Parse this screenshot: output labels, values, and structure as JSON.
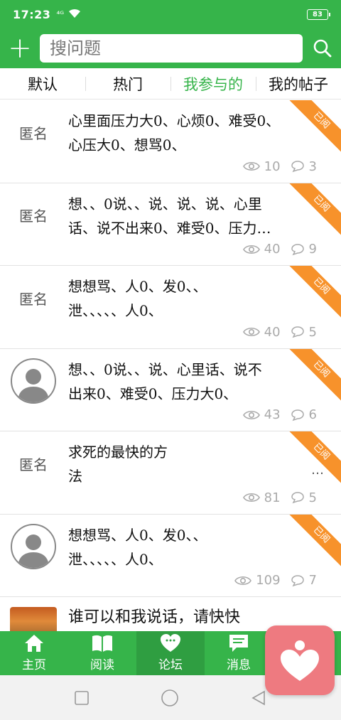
{
  "status": {
    "time": "17:23",
    "signal": "⁴ᴳ",
    "battery": "83"
  },
  "search": {
    "placeholder": "搜问题"
  },
  "tabs": [
    {
      "label": "默认"
    },
    {
      "label": "热门"
    },
    {
      "label": "我参与的"
    },
    {
      "label": "我的帖子"
    }
  ],
  "posts": [
    {
      "author": "匿名",
      "text": "心里面压力大0、心烦0、难受0、\n心压大0、想骂0、",
      "views": "10",
      "comments": "3",
      "badge": "已阅"
    },
    {
      "author": "匿名",
      "text": "想、、0说、、说、说、说、心里\n话、说不出来0、难受0、压力…",
      "views": "40",
      "comments": "9",
      "badge": "已阅"
    },
    {
      "author": "匿名",
      "text": "想想骂、人0、发0、、\n泄、、、、、人0、",
      "views": "40",
      "comments": "5",
      "badge": "已阅"
    },
    {
      "author": "",
      "text": "想、、0说、、说、心里话、说不\n出来0、难受0、压力大0、",
      "views": "43",
      "comments": "6",
      "badge": "已阅"
    },
    {
      "author": "匿名",
      "text": "求死的最快的方\n法",
      "more": "…",
      "views": "81",
      "comments": "5",
      "badge": "已阅"
    },
    {
      "author": "",
      "text": "想想骂、人0、发0、、\n泄、、、、、人0、",
      "views": "109",
      "comments": "7",
      "badge": "已阅"
    }
  ],
  "partial_post": {
    "text": "谁可以和我说话，请快快"
  },
  "nav": [
    {
      "label": "主页"
    },
    {
      "label": "阅读"
    },
    {
      "label": "论坛"
    },
    {
      "label": "消息"
    }
  ],
  "colors": {
    "brand": "#36b44a",
    "ribbon": "#f7922b",
    "floating": "#ee7a80"
  }
}
